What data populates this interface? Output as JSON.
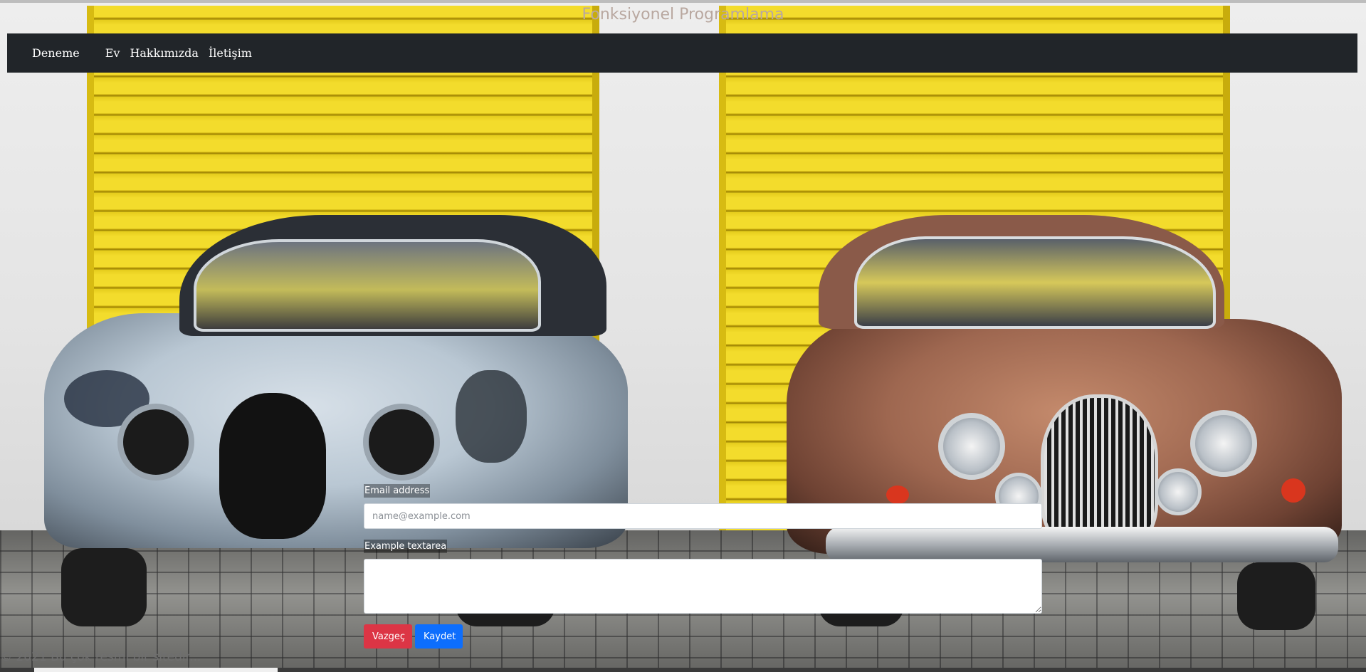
{
  "header": {
    "title": "Fonksiyonel Programlama"
  },
  "navbar": {
    "brand": "Deneme",
    "links": [
      "Ev",
      "Hakkımızda",
      "İletişim"
    ]
  },
  "form": {
    "email_label": "Email address",
    "email_placeholder": "name@example.com",
    "email_value": "",
    "textarea_label": "Example textarea",
    "textarea_value": "",
    "cancel_label": "Vazgeç",
    "save_label": "Kaydet"
  },
  "footer": {
    "text": "© 2021 Bu çok resmi bir sitedir..."
  },
  "colors": {
    "navbar_bg": "#212529",
    "cancel_button": "#dc3545",
    "save_button": "#0d6efd"
  }
}
